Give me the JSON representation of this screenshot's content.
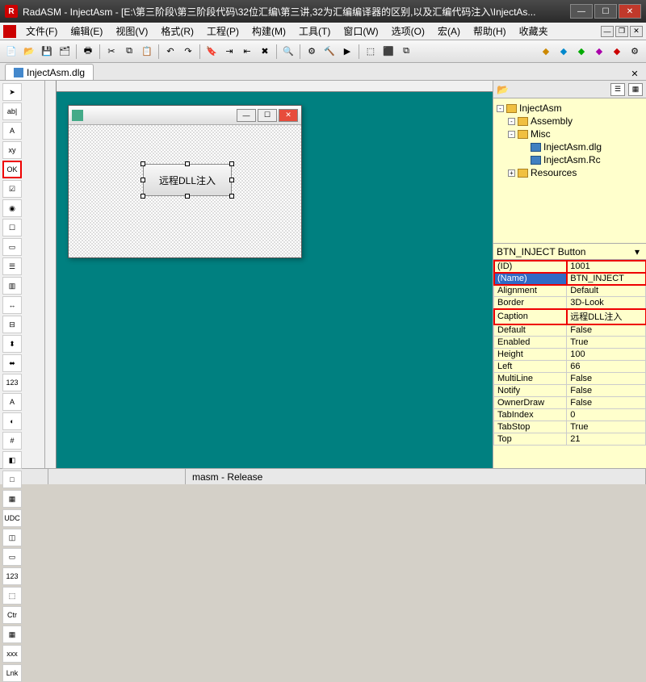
{
  "window": {
    "app": "RadASM",
    "title": "RadASM - InjectAsm - [E:\\第三阶段\\第三阶段代码\\32位汇编\\第三讲,32为汇编编译器的区别,以及汇编代码注入\\InjectAs..."
  },
  "menu": [
    "文件(F)",
    "编辑(E)",
    "视图(V)",
    "格式(R)",
    "工程(P)",
    "构建(M)",
    "工具(T)",
    "窗口(W)",
    "选项(O)",
    "宏(A)",
    "帮助(H)",
    "收藏夹"
  ],
  "tabs": {
    "active": "InjectAsm.dlg"
  },
  "toolbox": [
    "➤",
    "ab|",
    "A",
    "xy",
    "OK",
    "☑",
    "◉",
    "☐",
    "▭",
    "☰",
    "▥",
    "↔",
    "⊟",
    "⬍",
    "⬌",
    "123",
    "A",
    "◐",
    "#",
    "◧",
    "□",
    "▦",
    "UDC",
    "◫",
    "▭",
    "123",
    "⬚",
    "Ctr",
    "▦",
    "xxx",
    "Lnk"
  ],
  "dialog": {
    "button_caption": "远程DLL注入"
  },
  "project": {
    "root": "InjectAsm",
    "folders": [
      {
        "name": "Assembly",
        "expand": "-",
        "items": []
      },
      {
        "name": "Misc",
        "expand": "-",
        "items": [
          "InjectAsm.dlg",
          "InjectAsm.Rc"
        ]
      },
      {
        "name": "Resources",
        "expand": "+",
        "items": []
      }
    ]
  },
  "prop_object": "BTN_INJECT Button",
  "properties": [
    {
      "k": "(ID)",
      "v": "1001",
      "hi": "red"
    },
    {
      "k": "(Name)",
      "v": "BTN_INJECT",
      "hi": "red",
      "sel": true
    },
    {
      "k": "Alignment",
      "v": "Default"
    },
    {
      "k": "Border",
      "v": "3D-Look"
    },
    {
      "k": "Caption",
      "v": "远程DLL注入",
      "hi": "red"
    },
    {
      "k": "Default",
      "v": "False"
    },
    {
      "k": "Enabled",
      "v": "True"
    },
    {
      "k": "Height",
      "v": "100"
    },
    {
      "k": "Left",
      "v": "66"
    },
    {
      "k": "MultiLine",
      "v": "False"
    },
    {
      "k": "Notify",
      "v": "False"
    },
    {
      "k": "OwnerDraw",
      "v": "False"
    },
    {
      "k": "TabIndex",
      "v": "0"
    },
    {
      "k": "TabStop",
      "v": "True"
    },
    {
      "k": "Top",
      "v": "21"
    }
  ],
  "status": {
    "config": "masm - Release"
  },
  "icons": {
    "minimize": "—",
    "maximize": "☐",
    "close": "✕",
    "restore": "❐",
    "dropdown": "▾",
    "folder_open": "📂"
  }
}
